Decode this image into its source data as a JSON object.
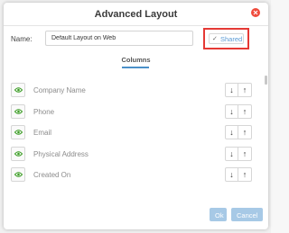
{
  "dialog": {
    "title": "Advanced Layout",
    "name_label": "Name:",
    "name_value": "Default Layout on Web",
    "shared_checked": true,
    "shared_label": "Shared",
    "tab_label": "Columns"
  },
  "columns": [
    {
      "label": "Company Name",
      "visible": true
    },
    {
      "label": "Phone",
      "visible": true
    },
    {
      "label": "Email",
      "visible": true
    },
    {
      "label": "Physical Address",
      "visible": true
    },
    {
      "label": "Created On",
      "visible": true
    }
  ],
  "arrows": {
    "down": "↓",
    "up": "↑"
  },
  "buttons": {
    "ok": "Ok",
    "cancel": "Cancel"
  },
  "colors": {
    "accent": "#4a90c8",
    "close": "#ef4b3c",
    "highlight": "#e53935",
    "eye": "#3a9d23",
    "button": "#a7c9e6"
  }
}
